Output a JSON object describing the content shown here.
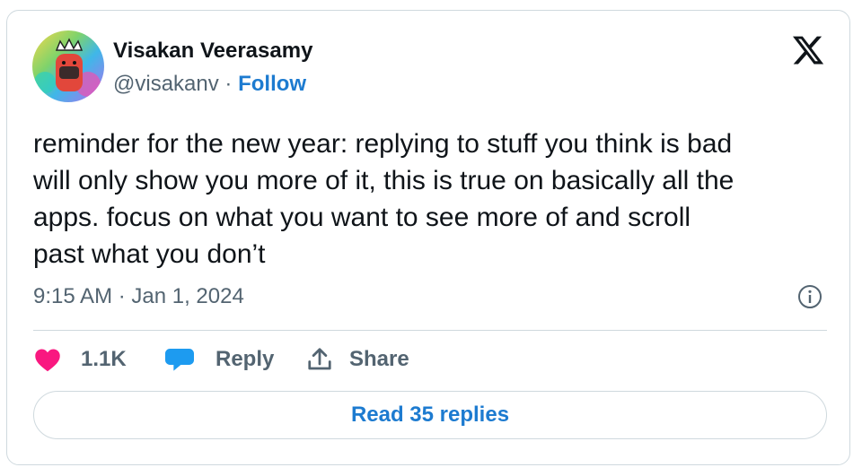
{
  "author": {
    "name": "Visakan Veerasamy",
    "handle": "@visakanv",
    "separator": "·",
    "follow_label": "Follow"
  },
  "tweet": {
    "lines": [
      "reminder for the new year: replying to stuff you think is bad",
      "will only show you more of it, this is true on basically all the",
      "apps. focus on what you want to see more of and scroll",
      "past what you don’t"
    ],
    "timestamp": "9:15 AM · Jan 1, 2024"
  },
  "actions": {
    "like_count": "1.1K",
    "reply_label": "Reply",
    "share_label": "Share"
  },
  "read_replies_label": "Read 35 replies",
  "icons": {
    "avatar": "avatar",
    "logo": "x-logo-icon",
    "info": "info-icon",
    "like": "heart-icon",
    "reply": "speech-bubble-icon",
    "share": "share-upload-icon"
  },
  "colors": {
    "link": "#1d7bd0",
    "like": "#f91880",
    "reply_icon": "#1d9bf0",
    "secondary_text": "#536471",
    "border": "#cfd9de"
  }
}
